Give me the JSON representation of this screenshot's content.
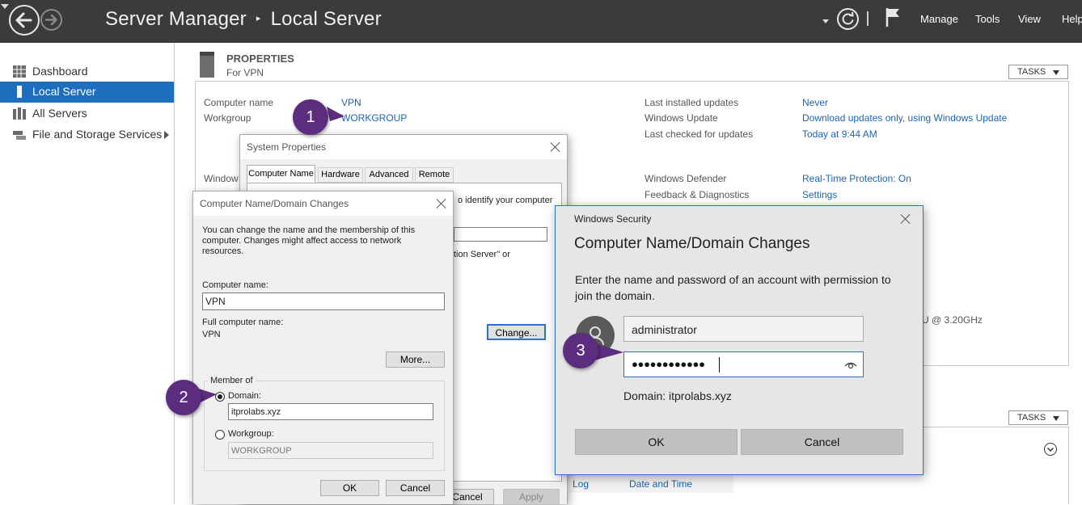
{
  "topbar": {
    "app_title": "Server Manager",
    "page_title": "Local Server",
    "menu": [
      "Manage",
      "Tools",
      "View",
      "Help"
    ]
  },
  "sidebar": {
    "items": [
      {
        "label": "Dashboard",
        "icon": "dashboard-grid-icon",
        "active": false
      },
      {
        "label": "Local Server",
        "icon": "server-icon",
        "active": true
      },
      {
        "label": "All Servers",
        "icon": "servers-icon",
        "active": false
      },
      {
        "label": "File and Storage Services",
        "icon": "storage-icon",
        "active": false,
        "has_submenu": true
      }
    ]
  },
  "properties": {
    "title": "PROPERTIES",
    "subtitle": "For VPN",
    "tasks_label": "TASKS",
    "left": [
      {
        "label": "Computer name",
        "value": "VPN"
      },
      {
        "label": "Workgroup",
        "value": "WORKGROUP"
      }
    ],
    "partial_label": "Window",
    "right": [
      {
        "label": "Last installed updates",
        "value": "Never"
      },
      {
        "label": "Windows Update",
        "value": "Download updates only, using Windows Update"
      },
      {
        "label": "Last checked for updates",
        "value": "Today at 9:44 AM"
      },
      {
        "label": "Windows Defender",
        "value": "Real-Time Protection: On"
      },
      {
        "label": "Feedback & Diagnostics",
        "value": "Settings"
      }
    ],
    "processor_fragment": "U @ 3.20GHz"
  },
  "events": {
    "tasks_label": "TASKS",
    "columns": [
      "Log",
      "Date and Time"
    ]
  },
  "system_properties": {
    "title": "System Properties",
    "tabs": [
      "Computer Name",
      "Hardware",
      "Advanced",
      "Remote"
    ],
    "active_tab": "Computer Name",
    "fragment_identify": "o identify your computer",
    "fragment_server": "tion Server\" or",
    "change_label": "Change...",
    "cancel_label": "Cancel",
    "apply_label": "Apply"
  },
  "name_changes": {
    "title": "Computer Name/Domain Changes",
    "description": "You can change the name and the membership of this computer. Changes might affect access to network resources.",
    "computer_name_label": "Computer name:",
    "computer_name_value": "VPN",
    "full_name_label": "Full computer name:",
    "full_name_value": "VPN",
    "more_label": "More...",
    "member_of_label": "Member of",
    "domain_label": "Domain:",
    "domain_value": "itprolabs.xyz",
    "workgroup_label": "Workgroup:",
    "workgroup_value": "WORKGROUP",
    "selected": "domain",
    "ok_label": "OK",
    "cancel_label": "Cancel"
  },
  "security": {
    "window_title": "Windows Security",
    "heading": "Computer Name/Domain Changes",
    "message": "Enter the name and password of an account with permission to join the domain.",
    "username_value": "administrator",
    "password_mask": "●●●●●●●●●●●●",
    "domain_line": "Domain: itprolabs.xyz",
    "ok_label": "OK",
    "cancel_label": "Cancel"
  },
  "callouts": [
    "1",
    "2",
    "3"
  ]
}
